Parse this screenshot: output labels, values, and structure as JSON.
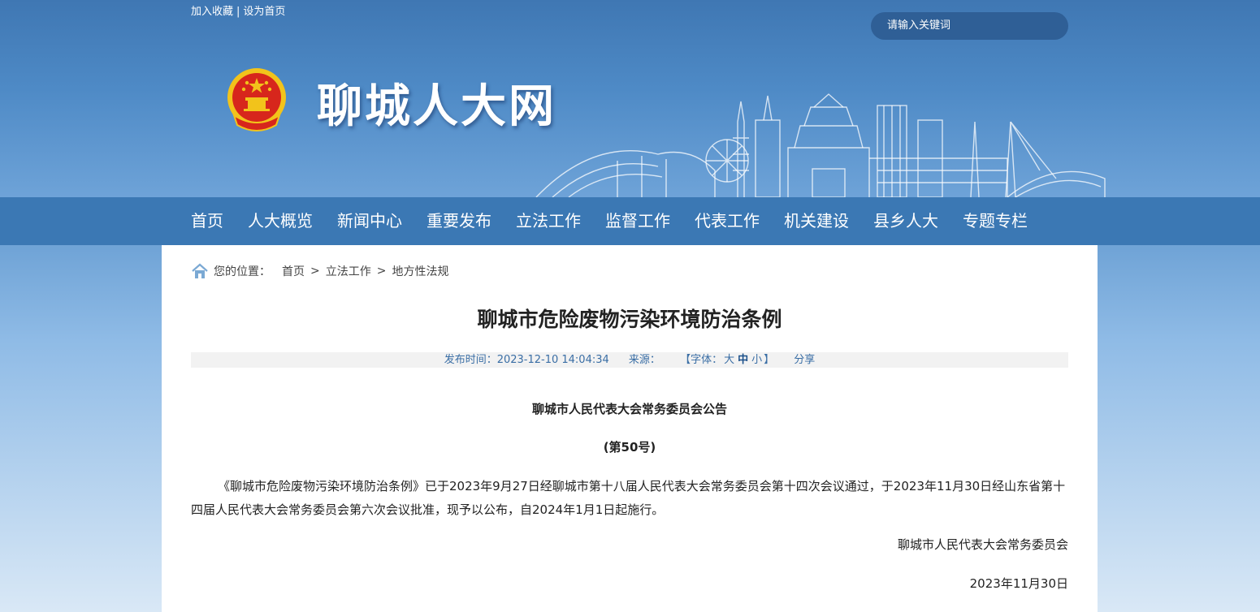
{
  "top_links": {
    "favorite": "加入收藏",
    "separator": "|",
    "homepage": "设为首页"
  },
  "search": {
    "placeholder": "请输入关键词"
  },
  "site": {
    "title": "聊城人大网"
  },
  "nav": [
    {
      "label": "首页"
    },
    {
      "label": "人大概览"
    },
    {
      "label": "新闻中心"
    },
    {
      "label": "重要发布"
    },
    {
      "label": "立法工作"
    },
    {
      "label": "监督工作"
    },
    {
      "label": "代表工作"
    },
    {
      "label": "机关建设"
    },
    {
      "label": "县乡人大"
    },
    {
      "label": "专题专栏"
    }
  ],
  "breadcrumb": {
    "label": "您的位置：",
    "items": [
      "首页",
      "立法工作",
      "地方性法规"
    ],
    "arrow": ">"
  },
  "article": {
    "title": "聊城市危险废物污染环境防治条例",
    "meta": {
      "publish_label": "发布时间：",
      "publish_time": "2023-12-10 14:04:34",
      "source_label": "来源：",
      "font_open": "【字体：",
      "font_large": "大",
      "font_medium": "中",
      "font_small": "小",
      "font_close": "】",
      "share": "分享"
    },
    "notice_head": "聊城市人民代表大会常务委员会公告",
    "notice_no": "(第50号)",
    "body": "《聊城市危险废物污染环境防治条例》已于2023年9月27日经聊城市第十八届人民代表大会常务委员会第十四次会议通过，于2023年11月30日经山东省第十四届人民代表大会常务委员会第六次会议批准，现予以公布，自2024年1月1日起施行。",
    "signature_org": "聊城市人民代表大会常务委员会",
    "signature_date": "2023年11月30日"
  },
  "colors": {
    "header_blue": "#4e8ac6",
    "nav_blue": "#3b78b4",
    "search_bg": "#2f5f96",
    "emblem_red": "#d7261c",
    "emblem_gold": "#f2c31b"
  }
}
